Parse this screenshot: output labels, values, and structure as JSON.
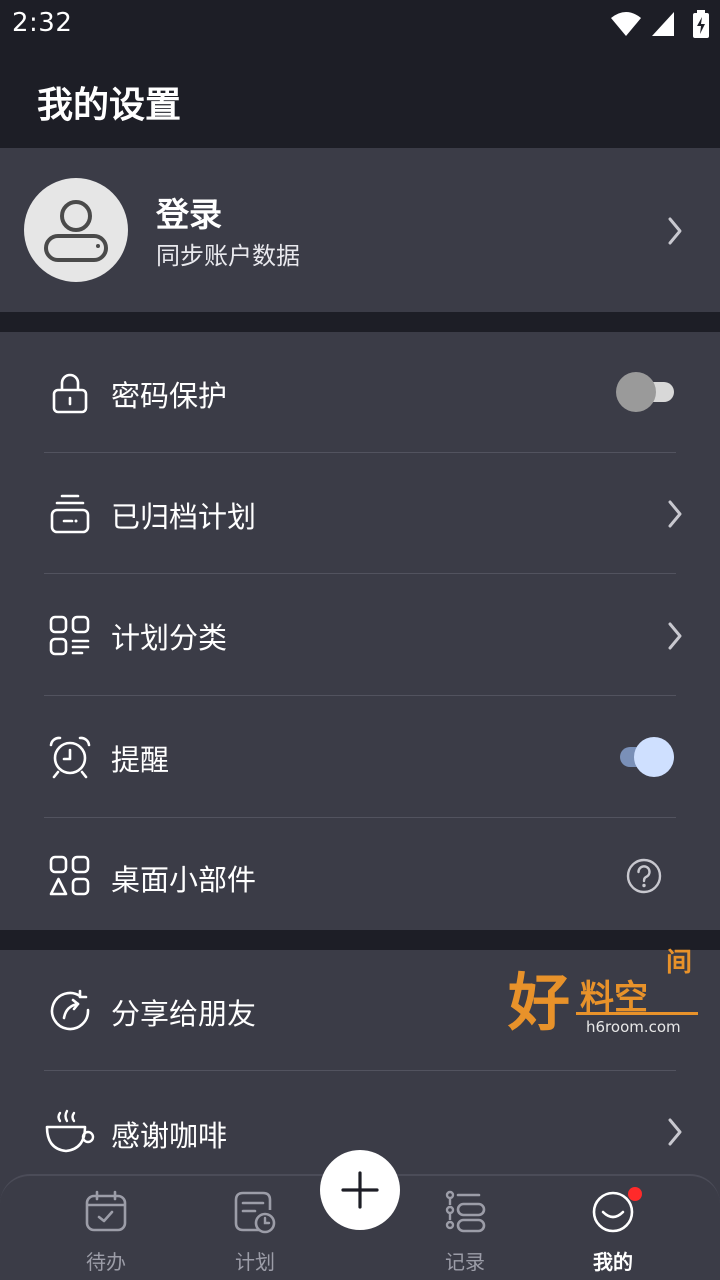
{
  "status_bar": {
    "time": "2:32",
    "icons": [
      "wifi-icon",
      "signal-icon",
      "battery-charging-icon"
    ]
  },
  "header": {
    "title": "我的设置"
  },
  "login": {
    "title": "登录",
    "subtitle": "同步账户数据"
  },
  "settings": {
    "password_protect": {
      "label": "密码保护",
      "icon": "lock-icon",
      "toggle_on": false
    },
    "archived_plans": {
      "label": "已归档计划",
      "icon": "archive-icon"
    },
    "plan_categories": {
      "label": "计划分类",
      "icon": "category-grid-icon"
    },
    "reminder": {
      "label": "提醒",
      "icon": "alarm-clock-icon",
      "toggle_on": true
    },
    "widgets": {
      "label": "桌面小部件",
      "icon": "widgets-icon"
    }
  },
  "more": {
    "share": {
      "label": "分享给朋友",
      "icon": "share-icon"
    },
    "coffee": {
      "label": "感谢咖啡",
      "icon": "coffee-cup-icon"
    }
  },
  "watermark": {
    "text_main": "好",
    "text_side": "料空",
    "text_top": "间",
    "domain": "h6room.com"
  },
  "bottom_nav": {
    "items": [
      {
        "label": "待办",
        "icon": "calendar-check-icon",
        "active": false
      },
      {
        "label": "计划",
        "icon": "plan-clock-icon",
        "active": false
      },
      {
        "label": "记录",
        "icon": "record-list-icon",
        "active": false
      },
      {
        "label": "我的",
        "icon": "smile-face-icon",
        "active": true
      }
    ],
    "fab_icon": "plus-icon"
  },
  "colors": {
    "background": "#1d1e26",
    "card": "#3b3c47",
    "toggle_off": "#9a9a9a",
    "toggle_on": "#cfe0ff",
    "badge": "#ff2a2a",
    "watermark": "#e8922a"
  }
}
